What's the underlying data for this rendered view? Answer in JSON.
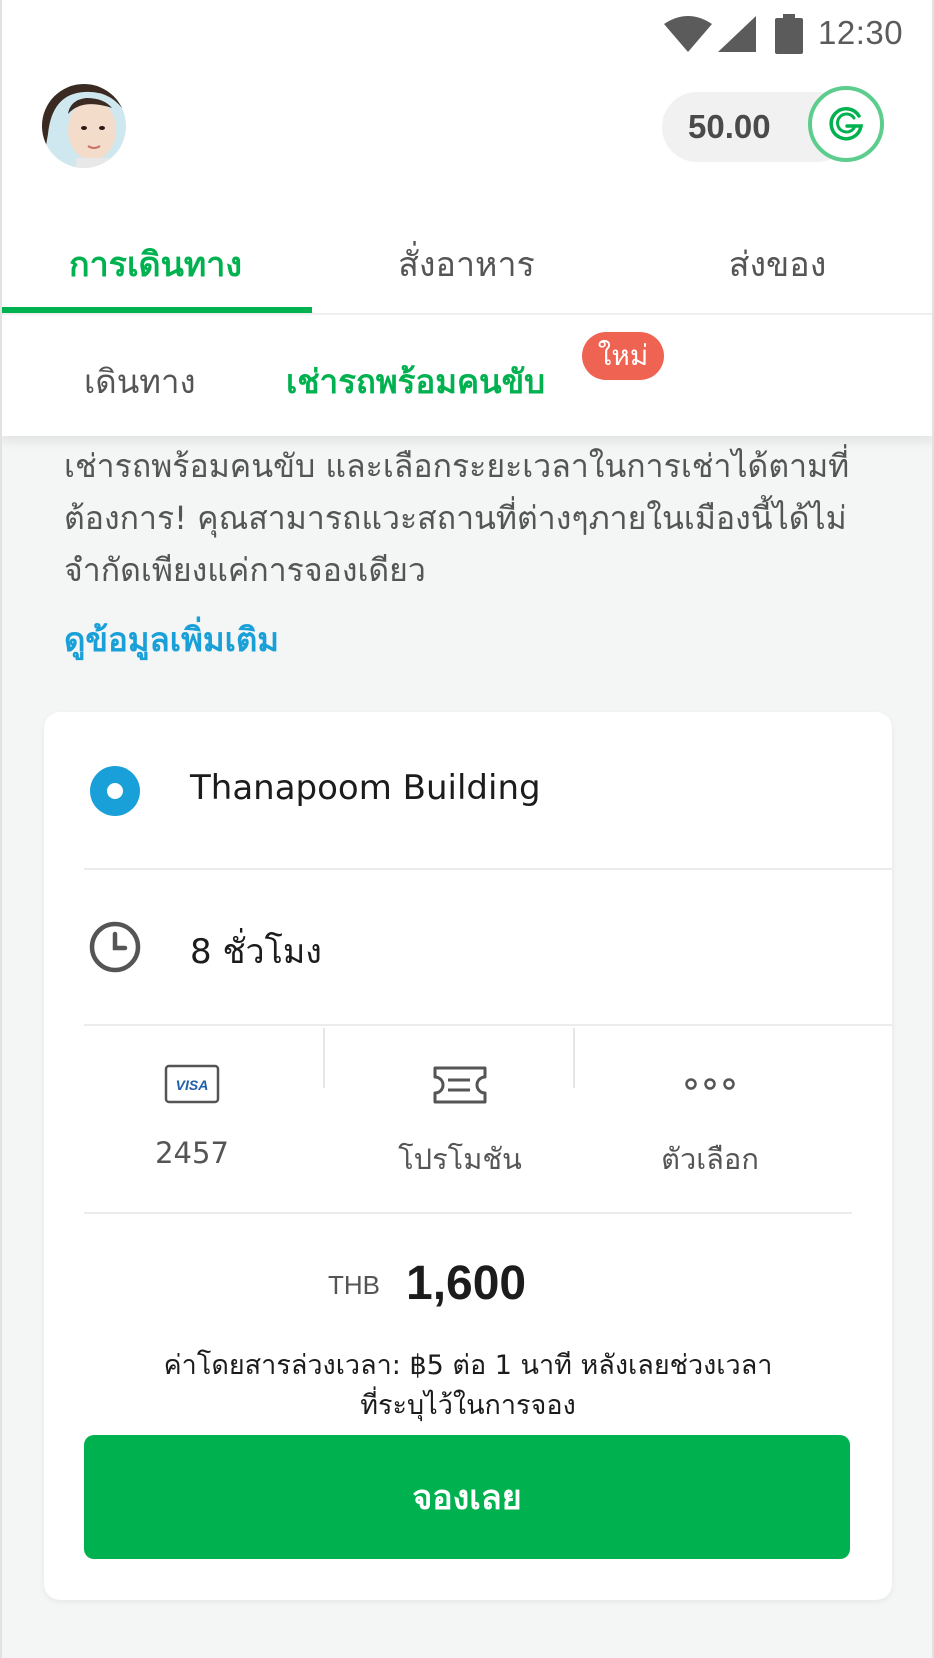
{
  "status_bar": {
    "time": "12:30",
    "icons": [
      "wifi-icon",
      "signal-icon",
      "battery-icon"
    ]
  },
  "profile": {
    "avatar": "user-avatar"
  },
  "wallet": {
    "balance": "50.00",
    "icon": "grabpay-g-icon",
    "brand_color": "#5ccd8d"
  },
  "main_tabs": [
    {
      "label": "การเดินทาง",
      "active": true
    },
    {
      "label": "สั่งอาหาร",
      "active": false
    },
    {
      "label": "ส่งของ",
      "active": false
    }
  ],
  "sub_tabs": [
    {
      "label": "เดินทาง",
      "active": false
    },
    {
      "label": "เช่ารถพร้อมคนขับ",
      "active": true
    }
  ],
  "new_badge": "ใหม่",
  "description": {
    "lines": [
      "เช่ารถพร้อมคนขับ และเลือกระยะเวลาในการเช่าได้ตามที่",
      "ต้องการ! คุณสามารถแวะสถานที่ต่างๆภายในเมืองนี้ได้ไม่",
      "จำกัดเพียงแค่การจองเดียว"
    ]
  },
  "more_info_link": "ดูข้อมูลเพิ่มเติม",
  "booking": {
    "pickup": "Thanapoom Building",
    "duration": "8 ชั่วโมง",
    "payment": {
      "card_brand": "VISA",
      "label": "2457",
      "icon": "visa-card-icon"
    },
    "promotion": {
      "label": "โปรโมชัน",
      "icon": "ticket-icon"
    },
    "options": {
      "label": "ตัวเลือก",
      "icon": "more-dots-icon"
    },
    "currency": "THB",
    "price": "1,600",
    "overtime_note": [
      "ค่าโดยสารล่วงเวลา: ฿5 ต่อ 1 นาที หลังเลยช่วงเวลา",
      "ที่ระบุไว้ในการจอง"
    ],
    "book_button": "จองเลย"
  },
  "colors": {
    "brand_green": "#00b14f",
    "link_blue": "#1aa0d8",
    "badge_red": "#ee6352"
  }
}
